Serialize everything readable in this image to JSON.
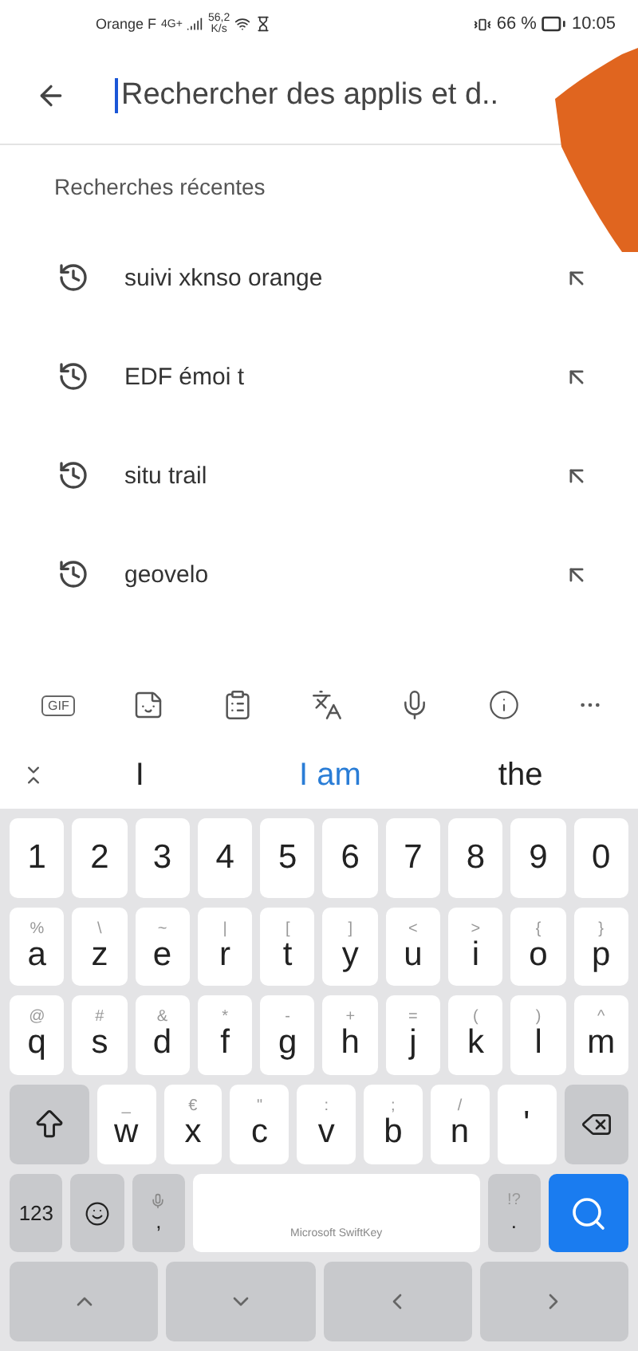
{
  "status_bar": {
    "carrier": "Orange F",
    "network": "4G+",
    "speed": "56,2",
    "speed_unit": "K/s",
    "battery": "66 %",
    "time": "10:05"
  },
  "search": {
    "placeholder": "Rechercher des applis et d.."
  },
  "recent": {
    "title": "Recherches récentes",
    "items": [
      {
        "label": "suivi xknso orange"
      },
      {
        "label": "EDF émoi t"
      },
      {
        "label": "situ trail"
      },
      {
        "label": "geovelo"
      }
    ]
  },
  "keyboard_toolbar": {
    "gif": "GIF"
  },
  "suggestions": [
    {
      "label": "I",
      "selected": false
    },
    {
      "label": "I am",
      "selected": true
    },
    {
      "label": "the",
      "selected": false
    }
  ],
  "keyboard": {
    "rows": [
      [
        {
          "kind": "char",
          "main": "1"
        },
        {
          "kind": "char",
          "main": "2"
        },
        {
          "kind": "char",
          "main": "3"
        },
        {
          "kind": "char",
          "main": "4"
        },
        {
          "kind": "char",
          "main": "5"
        },
        {
          "kind": "char",
          "main": "6"
        },
        {
          "kind": "char",
          "main": "7"
        },
        {
          "kind": "char",
          "main": "8"
        },
        {
          "kind": "char",
          "main": "9"
        },
        {
          "kind": "char",
          "main": "0"
        }
      ],
      [
        {
          "kind": "char",
          "main": "a",
          "alt": "%"
        },
        {
          "kind": "char",
          "main": "z",
          "alt": "\\"
        },
        {
          "kind": "char",
          "main": "e",
          "alt": "~"
        },
        {
          "kind": "char",
          "main": "r",
          "alt": "|"
        },
        {
          "kind": "char",
          "main": "t",
          "alt": "["
        },
        {
          "kind": "char",
          "main": "y",
          "alt": "]"
        },
        {
          "kind": "char",
          "main": "u",
          "alt": "<"
        },
        {
          "kind": "char",
          "main": "i",
          "alt": ">"
        },
        {
          "kind": "char",
          "main": "o",
          "alt": "{"
        },
        {
          "kind": "char",
          "main": "p",
          "alt": "}"
        }
      ],
      [
        {
          "kind": "char",
          "main": "q",
          "alt": "@"
        },
        {
          "kind": "char",
          "main": "s",
          "alt": "#"
        },
        {
          "kind": "char",
          "main": "d",
          "alt": "&"
        },
        {
          "kind": "char",
          "main": "f",
          "alt": "*"
        },
        {
          "kind": "char",
          "main": "g",
          "alt": "-"
        },
        {
          "kind": "char",
          "main": "h",
          "alt": "+"
        },
        {
          "kind": "char",
          "main": "j",
          "alt": "="
        },
        {
          "kind": "char",
          "main": "k",
          "alt": "("
        },
        {
          "kind": "char",
          "main": "l",
          "alt": ")"
        },
        {
          "kind": "char",
          "main": "m",
          "alt": "^"
        }
      ],
      [
        {
          "kind": "shift"
        },
        {
          "kind": "char",
          "main": "w",
          "alt": "_"
        },
        {
          "kind": "char",
          "main": "x",
          "alt": "€"
        },
        {
          "kind": "char",
          "main": "c",
          "alt": "\""
        },
        {
          "kind": "char",
          "main": "v",
          "alt": ":"
        },
        {
          "kind": "char",
          "main": "b",
          "alt": ";"
        },
        {
          "kind": "char",
          "main": "n",
          "alt": "/"
        },
        {
          "kind": "char",
          "main": "'"
        },
        {
          "kind": "backspace"
        }
      ],
      [
        {
          "kind": "symbols",
          "main": "123"
        },
        {
          "kind": "emoji"
        },
        {
          "kind": "mic",
          "main": ","
        },
        {
          "kind": "space"
        },
        {
          "kind": "period",
          "main": ".",
          "alt": "!?"
        },
        {
          "kind": "search"
        }
      ],
      [
        {
          "kind": "up"
        },
        {
          "kind": "down"
        },
        {
          "kind": "left"
        },
        {
          "kind": "right"
        }
      ]
    ],
    "space_label": "Microsoft SwiftKey"
  }
}
